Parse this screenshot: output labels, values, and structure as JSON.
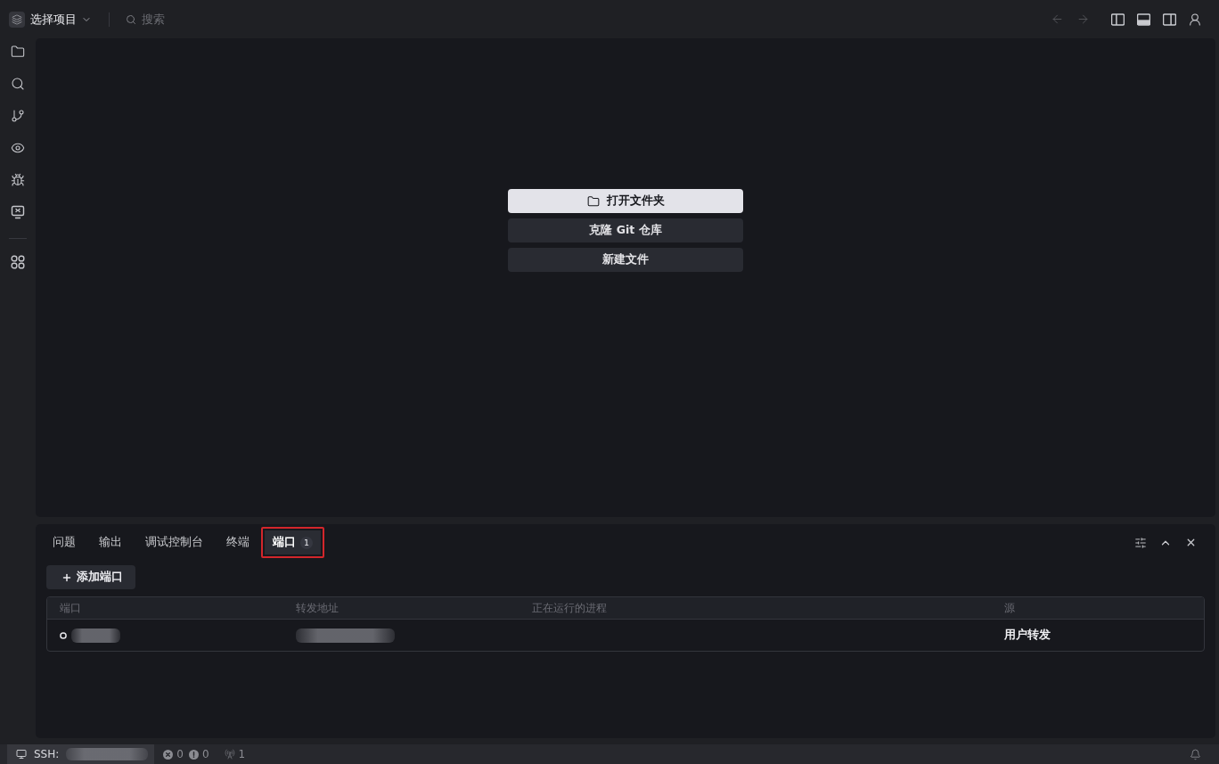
{
  "title_bar": {
    "project_picker": {
      "label": "选择项目"
    },
    "search": {
      "placeholder": "搜索"
    },
    "navigation": [
      {
        "kind": "back",
        "disabled": true
      },
      {
        "kind": "forward",
        "disabled": true
      }
    ],
    "layout_toggles": [
      {
        "kind": "primary_sidebar",
        "on": false
      },
      {
        "kind": "panel",
        "on": true
      },
      {
        "kind": "secondary_sidebar",
        "on": false
      }
    ]
  },
  "activity_bar": {
    "groups": [
      {
        "items": [
          {
            "kind": "explorer",
            "selected": false
          },
          {
            "kind": "search",
            "selected": false
          },
          {
            "kind": "source_control",
            "selected": false
          },
          {
            "kind": "remote",
            "selected": false
          },
          {
            "kind": "debug",
            "selected": false
          },
          {
            "kind": "remote_explorer",
            "selected": false
          }
        ]
      },
      {
        "items": [
          {
            "kind": "extensions",
            "selected": false
          }
        ]
      }
    ]
  },
  "welcome": {
    "actions": [
      {
        "kind": "open_folder",
        "label": "打开文件夹",
        "primary": true
      },
      {
        "kind": "clone_repository",
        "label": "克隆 Git 仓库",
        "primary": false
      },
      {
        "kind": "new_file",
        "label": "新建文件",
        "primary": false
      }
    ]
  },
  "panel": {
    "tabs": [
      {
        "label": "问题",
        "selected": false,
        "highlighted": false
      },
      {
        "label": "输出",
        "selected": false,
        "highlighted": false
      },
      {
        "label": "调试控制台",
        "selected": false,
        "highlighted": false
      },
      {
        "label": "终端",
        "selected": false,
        "highlighted": false
      },
      {
        "label": "端口",
        "badge": "1",
        "selected": true,
        "highlighted": true
      }
    ],
    "ports": {
      "add_button": {
        "label": "添加端口"
      },
      "columns": [
        "端口",
        "转发地址",
        "正在运行的进程",
        "源"
      ],
      "rows": [
        {
          "port": {
            "redacted": true
          },
          "address": {
            "redacted": true
          },
          "source": "用户转发"
        }
      ]
    }
  },
  "status_bar": {
    "remote": {
      "label": "SSH:",
      "host": {
        "redacted": true
      }
    },
    "errors": "0",
    "warnings": "0",
    "forwarded_ports": "1"
  }
}
